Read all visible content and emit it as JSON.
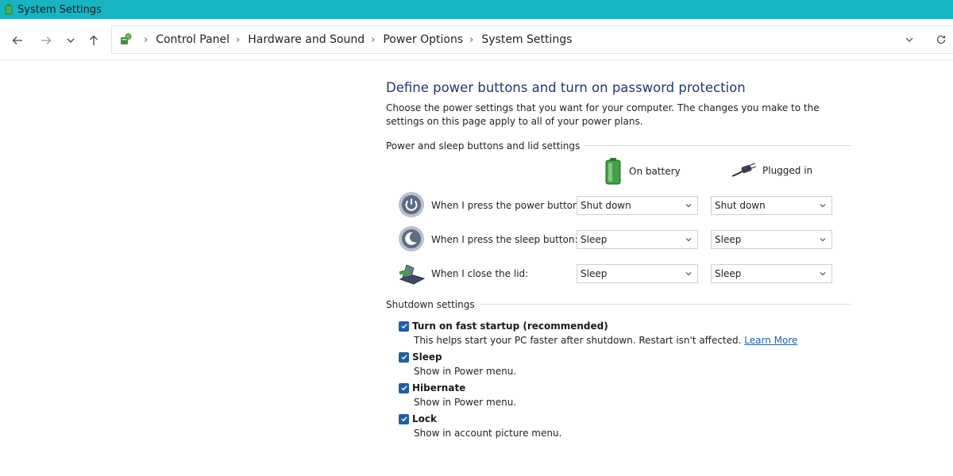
{
  "window": {
    "title": "System Settings"
  },
  "navigation": {
    "breadcrumb": [
      "Control Panel",
      "Hardware and Sound",
      "Power Options",
      "System Settings"
    ]
  },
  "page": {
    "heading": "Define power buttons and turn on password protection",
    "description": "Choose the power settings that you want for your computer. The changes you make to the settings on this page apply to all of your power plans."
  },
  "buttons_section": {
    "label": "Power and sleep buttons and lid settings",
    "columns": {
      "battery": "On battery",
      "plugged": "Plugged in"
    },
    "rows": [
      {
        "label": "When I press the power button:",
        "battery": "Shut down",
        "plugged": "Shut down",
        "icon": "power-button-icon"
      },
      {
        "label": "When I press the sleep button:",
        "battery": "Sleep",
        "plugged": "Sleep",
        "icon": "sleep-button-icon"
      },
      {
        "label": "When I close the lid:",
        "battery": "Sleep",
        "plugged": "Sleep",
        "icon": "laptop-lid-icon"
      }
    ]
  },
  "shutdown_section": {
    "label": "Shutdown settings",
    "items": [
      {
        "label": "Turn on fast startup (recommended)",
        "sub": "This helps start your PC faster after shutdown. Restart isn't affected.",
        "link": "Learn More",
        "checked": true
      },
      {
        "label": "Sleep",
        "sub": "Show in Power menu.",
        "checked": true
      },
      {
        "label": "Hibernate",
        "sub": "Show in Power menu.",
        "checked": true
      },
      {
        "label": "Lock",
        "sub": "Show in account picture menu.",
        "checked": true
      }
    ]
  },
  "colors": {
    "titlebar": "#17b4c2",
    "heading": "#1e3a6e",
    "accent": "#1f5fa8"
  }
}
